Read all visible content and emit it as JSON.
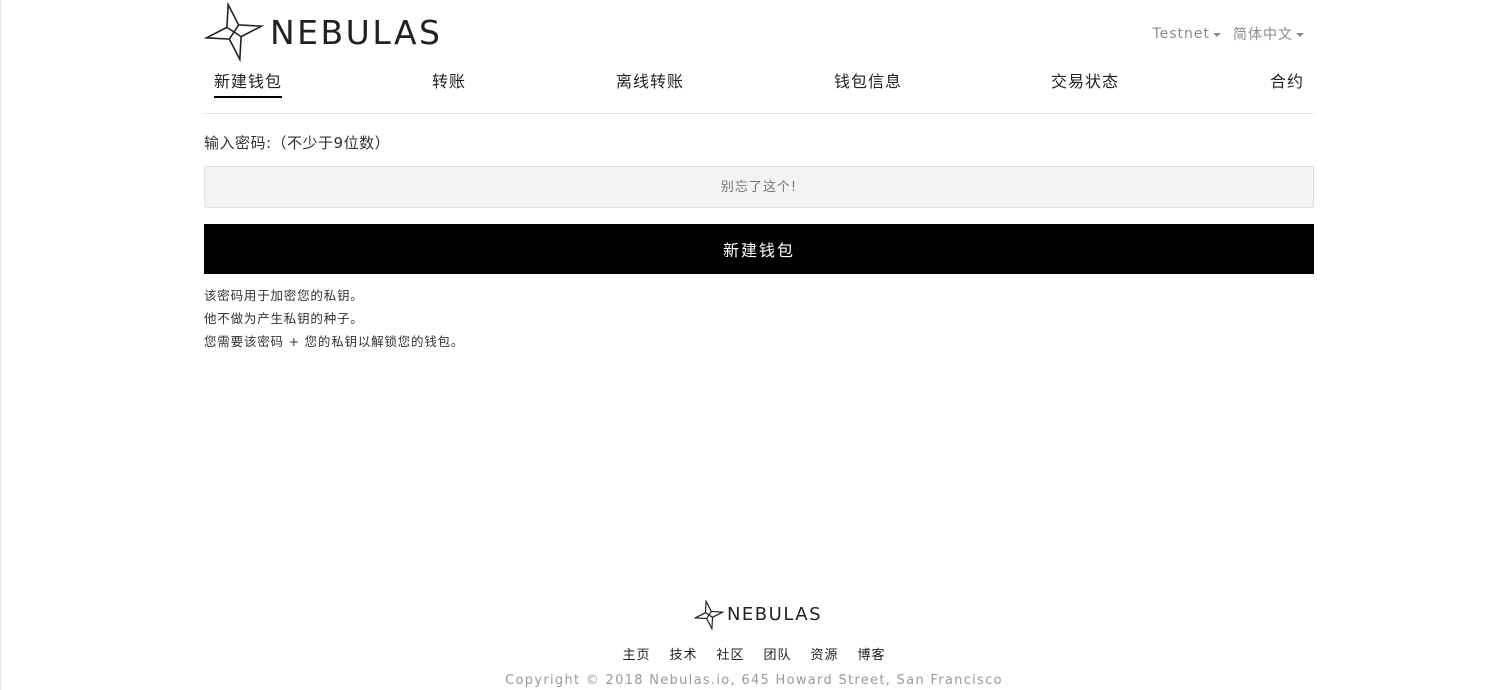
{
  "brand": {
    "name": "NEBULAS"
  },
  "header": {
    "network_label": "Testnet",
    "language_label": "简体中文"
  },
  "nav": {
    "items": [
      {
        "label": "新建钱包"
      },
      {
        "label": "转账"
      },
      {
        "label": "离线转账"
      },
      {
        "label": "钱包信息"
      },
      {
        "label": "交易状态"
      },
      {
        "label": "合约"
      }
    ],
    "active_index": 0
  },
  "form": {
    "password_label": "输入密码:（不少于9位数）",
    "password_placeholder": "别忘了这个!",
    "password_value": "",
    "create_button_label": "新建钱包",
    "notes": [
      "该密码用于加密您的私钥。",
      "他不做为产生私钥的种子。",
      "您需要该密码 + 您的私钥以解锁您的钱包。"
    ]
  },
  "footer": {
    "brand": "NEBULAS",
    "links": [
      {
        "label": "主页"
      },
      {
        "label": "技术"
      },
      {
        "label": "社区"
      },
      {
        "label": "团队"
      },
      {
        "label": "资源"
      },
      {
        "label": "博客"
      }
    ],
    "copyright": "Copyright © 2018 Nebulas.io, 645 Howard Street, San Francisco"
  }
}
